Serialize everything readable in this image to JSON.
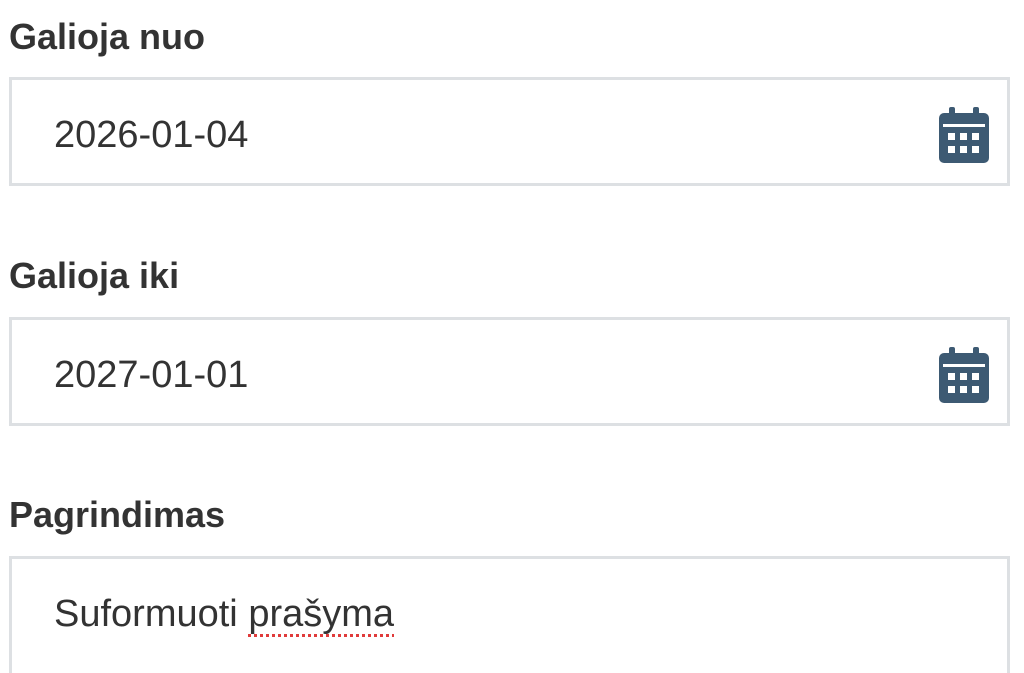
{
  "form": {
    "valid_from": {
      "label": "Galioja nuo",
      "value": "2026-01-04",
      "icon": "calendar-icon"
    },
    "valid_to": {
      "label": "Galioja iki",
      "value": "2027-01-01",
      "icon": "calendar-icon"
    },
    "reason": {
      "label": "Pagrindimas",
      "value_part1": "Suformuoti ",
      "value_part2": "prašyma"
    }
  },
  "colors": {
    "text": "#333333",
    "border": "#dde0e3",
    "icon": "#3d5a73",
    "spellcheck": "#e03b3b"
  }
}
